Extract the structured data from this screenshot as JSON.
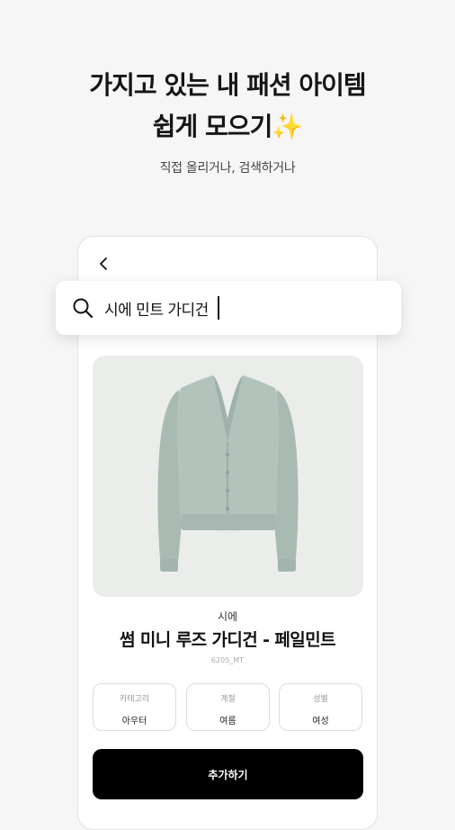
{
  "hero": {
    "line1": "가지고 있는 내 패션 아이템",
    "line2": "쉽게 모으기",
    "sparkle": "✨",
    "subtitle": "직접 올리거나, 검색하거나"
  },
  "search": {
    "query": "시에 민트 가디건"
  },
  "product": {
    "image_icon": "cardigan-image",
    "image_color": "#aebfb8",
    "brand": "시에",
    "name": "썸 미니 루즈 가디건 - 페일민트",
    "code": "6205_MT"
  },
  "attributes": [
    {
      "key": "카테고리",
      "value": "아우터"
    },
    {
      "key": "계절",
      "value": "여름"
    },
    {
      "key": "성별",
      "value": "여성"
    }
  ],
  "actions": {
    "add_label": "추가하기"
  }
}
